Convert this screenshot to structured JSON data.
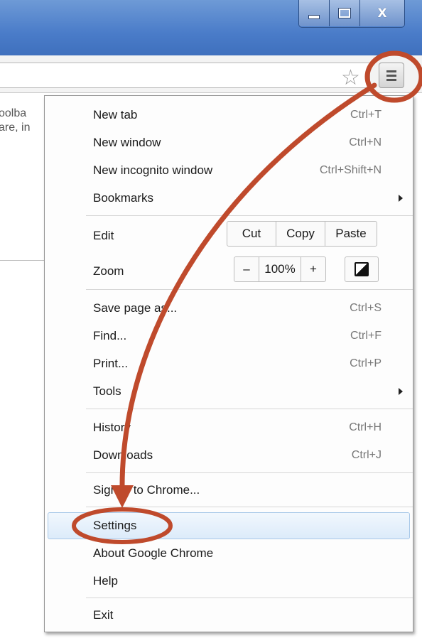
{
  "window": {
    "min_glyph": "",
    "max_glyph": "",
    "close_glyph": "X"
  },
  "page": {
    "text_line1": "oolba",
    "text_line2": "are, in"
  },
  "menu": {
    "items": [
      {
        "label": "New tab",
        "shortcut": "Ctrl+T"
      },
      {
        "label": "New window",
        "shortcut": "Ctrl+N"
      },
      {
        "label": "New incognito window",
        "shortcut": "Ctrl+Shift+N"
      },
      {
        "label": "Bookmarks",
        "shortcut": ""
      }
    ],
    "edit": {
      "label": "Edit",
      "cut": "Cut",
      "copy": "Copy",
      "paste": "Paste"
    },
    "zoom": {
      "label": "Zoom",
      "minus": "–",
      "level": "100%",
      "plus": "+"
    },
    "items2": [
      {
        "label": "Save page as...",
        "shortcut": "Ctrl+S"
      },
      {
        "label": "Find...",
        "shortcut": "Ctrl+F"
      },
      {
        "label": "Print...",
        "shortcut": "Ctrl+P"
      },
      {
        "label": "Tools",
        "shortcut": ""
      }
    ],
    "items3": [
      {
        "label": "History",
        "shortcut": "Ctrl+H"
      },
      {
        "label": "Downloads",
        "shortcut": "Ctrl+J"
      }
    ],
    "signin": "Sign in to Chrome...",
    "items4": [
      {
        "label": "Settings"
      },
      {
        "label": "About Google Chrome"
      },
      {
        "label": "Help"
      }
    ],
    "exit": "Exit"
  },
  "colors": {
    "annotation": "#bf4a2c",
    "highlight_border": "#a8c8e8",
    "titlebar": "#4a7cc9"
  }
}
